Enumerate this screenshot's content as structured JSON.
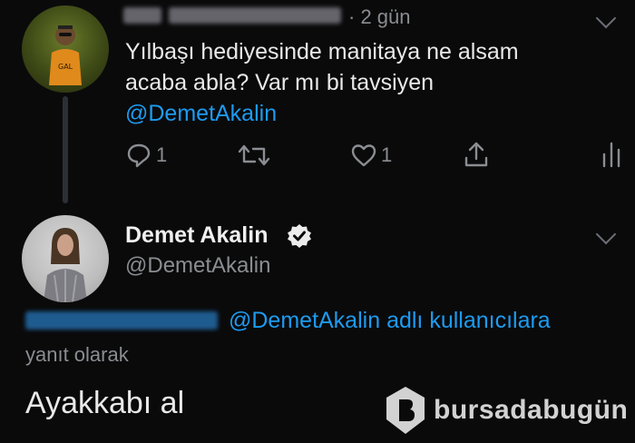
{
  "tweet1": {
    "time": "· 2 gün",
    "line1": "Yılbaşı hediyesinde manitaya ne alsam",
    "line2": "acaba abla? Var mı bi tavsiyen",
    "mention": "@DemetAkalin",
    "replies": "1",
    "likes": "1"
  },
  "tweet2": {
    "name": "Demet Akalin",
    "handle": "@DemetAkalin",
    "reply_context_mention": "@DemetAkalin",
    "reply_context_suffix": "adlı kullanıcılara",
    "reply_label": "yanıt olarak",
    "body": "Ayakkabı al"
  },
  "watermark": {
    "text": "bursadabugün"
  },
  "colors": {
    "background": "#0a0a0b",
    "link": "#1d9bf0",
    "muted": "#8a8d91"
  }
}
